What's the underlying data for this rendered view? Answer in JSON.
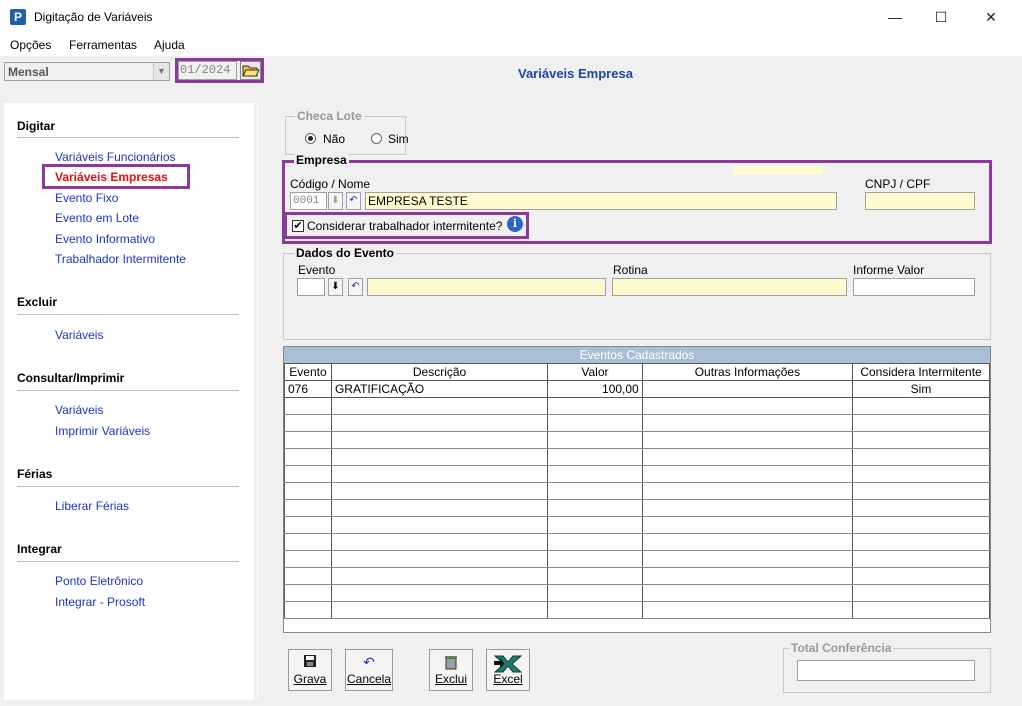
{
  "window": {
    "title": "Digitação de Variáveis",
    "app_icon_letter": "P",
    "minimize": "—",
    "maximize": "☐",
    "close": "✕"
  },
  "menu": [
    "Opções",
    "Ferramentas",
    "Ajuda"
  ],
  "toolbar": {
    "period_type": "Mensal",
    "period_value": "01/2024",
    "heading": "Variáveis Empresa"
  },
  "sidebar": {
    "sections": [
      {
        "title": "Digitar",
        "items": [
          "Variáveis Funcionários",
          "Variáveis Empresas",
          "Evento Fixo",
          "Evento em Lote",
          "Evento Informativo",
          "Trabalhador Intermitente"
        ]
      },
      {
        "title": "Excluir",
        "items": [
          "Variáveis"
        ]
      },
      {
        "title": "Consultar/Imprimir",
        "items": [
          "Variáveis",
          "Imprimir Variáveis"
        ]
      },
      {
        "title": "Férias",
        "items": [
          "Liberar Férias"
        ]
      },
      {
        "title": "Integrar",
        "items": [
          "Ponto Eletrônico",
          "Integrar - Prosoft"
        ]
      }
    ],
    "active_item": "Variáveis Empresas"
  },
  "checa_lote": {
    "legend": "Checa Lote",
    "option_nao": "Não",
    "option_sim": "Sim",
    "selected": "Não"
  },
  "empresa": {
    "legend": "Empresa",
    "codigo_label": "Código / Nome",
    "codigo_value": "0001",
    "nome_value": "EMPRESA TESTE",
    "cnpj_label": "CNPJ / CPF",
    "cnpj_value": "",
    "intermitente_label": "Considerar trabalhador intermitente?",
    "intermitente_checked": true
  },
  "dados_evento": {
    "legend": "Dados do Evento",
    "evento_label": "Evento",
    "rotina_label": "Rotina",
    "informe_label": "Informe Valor"
  },
  "grid": {
    "caption": "Eventos Cadastrados",
    "columns": [
      "Evento",
      "Descrição",
      "Valor",
      "Outras Informações",
      "Considera Intermitente"
    ],
    "rows": [
      [
        "076",
        "GRATIFICAÇÃO",
        "100,00",
        "",
        "Sim"
      ]
    ]
  },
  "buttons": {
    "grava": "Grava",
    "cancela": "Cancela",
    "exclui": "Exclui",
    "excel": "Excel"
  },
  "total_conferencia": {
    "legend": "Total Conferência",
    "value": ""
  },
  "colors": {
    "highlight_border": "#8b3a9c",
    "link": "#1c35c4",
    "active_link": "#e01010",
    "heading": "#1c46a8",
    "field_yellow": "#fffbd0"
  }
}
